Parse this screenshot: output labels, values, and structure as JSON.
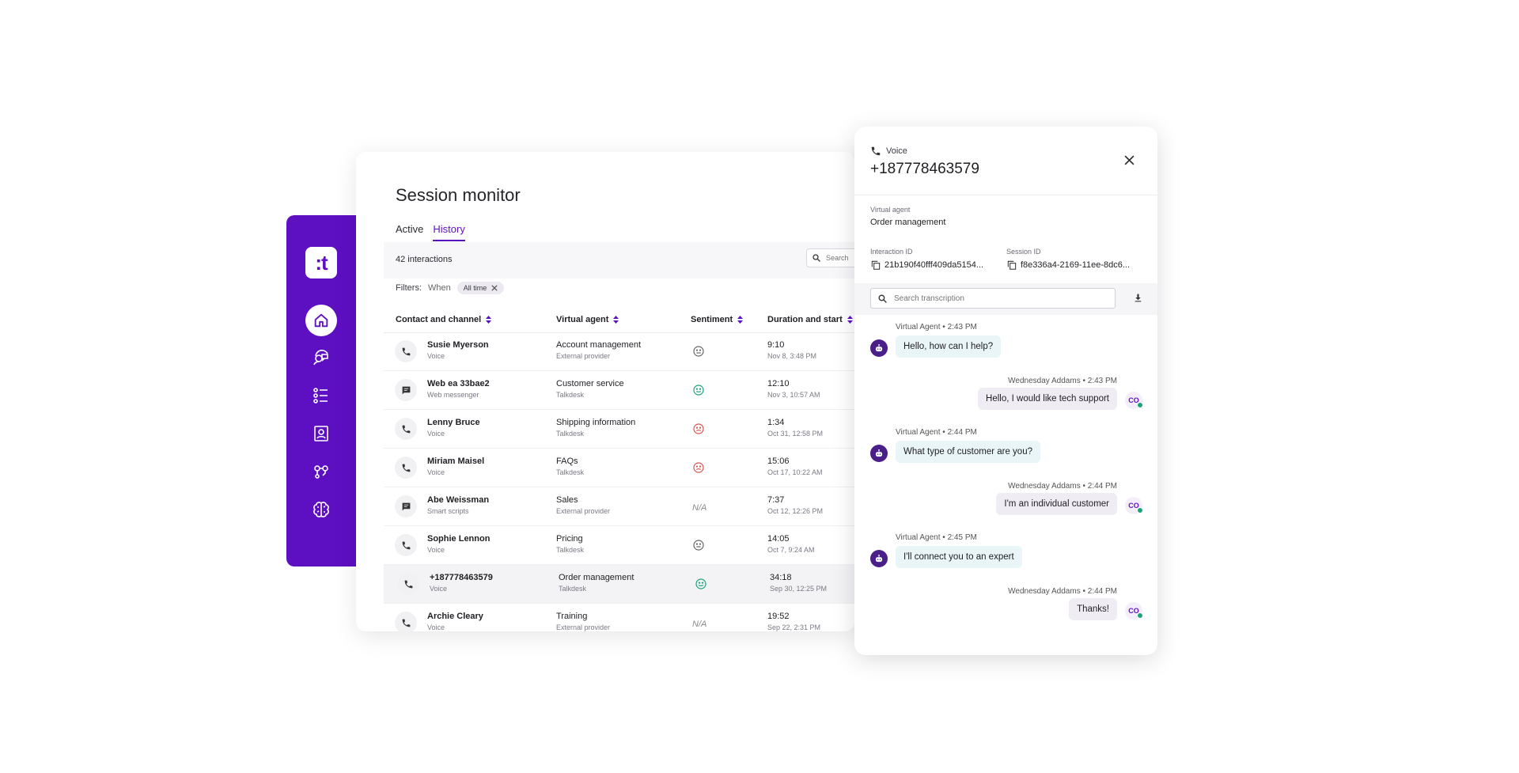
{
  "sidebar": {
    "logo_text": ":t",
    "items": [
      {
        "icon": "home-icon",
        "active": true
      },
      {
        "icon": "agent-support-icon",
        "active": false
      },
      {
        "icon": "list-icon",
        "active": false
      },
      {
        "icon": "contacts-icon",
        "active": false
      },
      {
        "icon": "flows-icon",
        "active": false
      },
      {
        "icon": "brain-icon",
        "active": false
      }
    ]
  },
  "main": {
    "title": "Session monitor",
    "tabs": [
      {
        "label": "Active",
        "active": false
      },
      {
        "label": "History",
        "active": true
      }
    ],
    "count_label": "42 interactions",
    "search_placeholder": "Search",
    "filters": {
      "label": "Filters:",
      "when_label": "When",
      "chip": "All time"
    },
    "columns": [
      "Contact and channel",
      "Virtual agent",
      "Sentiment",
      "Duration and start"
    ],
    "rows": [
      {
        "contact": "Susie Myerson",
        "channel": "Voice",
        "channel_icon": "phone-icon",
        "agent": "Account management",
        "provider": "External provider",
        "sentiment": "neutral",
        "duration": "9:10",
        "start": "Nov 8, 3:48 PM"
      },
      {
        "contact": "Web ea 33bae2",
        "channel": "Web messenger",
        "channel_icon": "chat-icon",
        "agent": "Customer service",
        "provider": "Talkdesk",
        "sentiment": "positive",
        "duration": "12:10",
        "start": "Nov 3, 10:57 AM"
      },
      {
        "contact": "Lenny Bruce",
        "channel": "Voice",
        "channel_icon": "phone-icon",
        "agent": "Shipping information",
        "provider": "Talkdesk",
        "sentiment": "negative",
        "duration": "1:34",
        "start": "Oct 31, 12:58 PM"
      },
      {
        "contact": "Miriam Maisel",
        "channel": "Voice",
        "channel_icon": "phone-icon",
        "agent": "FAQs",
        "provider": "Talkdesk",
        "sentiment": "negative",
        "duration": "15:06",
        "start": "Oct 17, 10:22 AM"
      },
      {
        "contact": "Abe Weissman",
        "channel": "Smart scripts",
        "channel_icon": "chat-icon",
        "agent": "Sales",
        "provider": "External provider",
        "sentiment": "N/A",
        "duration": "7:37",
        "start": "Oct 12, 12:26 PM"
      },
      {
        "contact": "Sophie Lennon",
        "channel": "Voice",
        "channel_icon": "phone-icon",
        "agent": "Pricing",
        "provider": "Talkdesk",
        "sentiment": "neutral",
        "duration": "14:05",
        "start": "Oct 7, 9:24 AM"
      },
      {
        "contact": "+187778463579",
        "channel": "Voice",
        "channel_icon": "phone-icon",
        "agent": "Order management",
        "provider": "Talkdesk",
        "sentiment": "positive",
        "duration": "34:18",
        "start": "Sep 30, 12:25 PM",
        "selected": true
      },
      {
        "contact": "Archie Cleary",
        "channel": "Voice",
        "channel_icon": "phone-icon",
        "agent": "Training",
        "provider": "External provider",
        "sentiment": "N/A",
        "duration": "19:52",
        "start": "Sep 22, 2:31 PM"
      }
    ]
  },
  "panel": {
    "channel": "Voice",
    "number": "+187778463579",
    "virtual_agent_label": "Virtual agent",
    "virtual_agent_value": "Order management",
    "interaction_id_label": "Interaction ID",
    "interaction_id_value": "21b190f40fff409da5154...",
    "session_id_label": "Session ID",
    "session_id_value": "f8e336a4-2169-11ee-8dc6...",
    "transcription_placeholder": "Search transcription",
    "messages": [
      {
        "from": "agent",
        "meta": "Virtual Agent • 2:43 PM",
        "text": "Hello, how can I help?"
      },
      {
        "from": "user",
        "meta": "Wednesday Addams • 2:43 PM",
        "text": "Hello, I would like tech support",
        "initials": "CO"
      },
      {
        "from": "agent",
        "meta": "Virtual Agent • 2:44 PM",
        "text": "What type of customer are you?"
      },
      {
        "from": "user",
        "meta": "Wednesday Addams • 2:44 PM",
        "text": "I'm an individual customer",
        "initials": "CO"
      },
      {
        "from": "agent",
        "meta": "Virtual Agent • 2:45 PM",
        "text": "I'll connect you to an expert"
      },
      {
        "from": "user",
        "meta": "Wednesday Addams • 2:44 PM",
        "text": "Thanks!",
        "initials": "CO"
      }
    ]
  },
  "colors": {
    "brand": "#5d0fc2",
    "positive": "#1aa37a",
    "negative": "#d9534f",
    "neutral": "#666666"
  }
}
